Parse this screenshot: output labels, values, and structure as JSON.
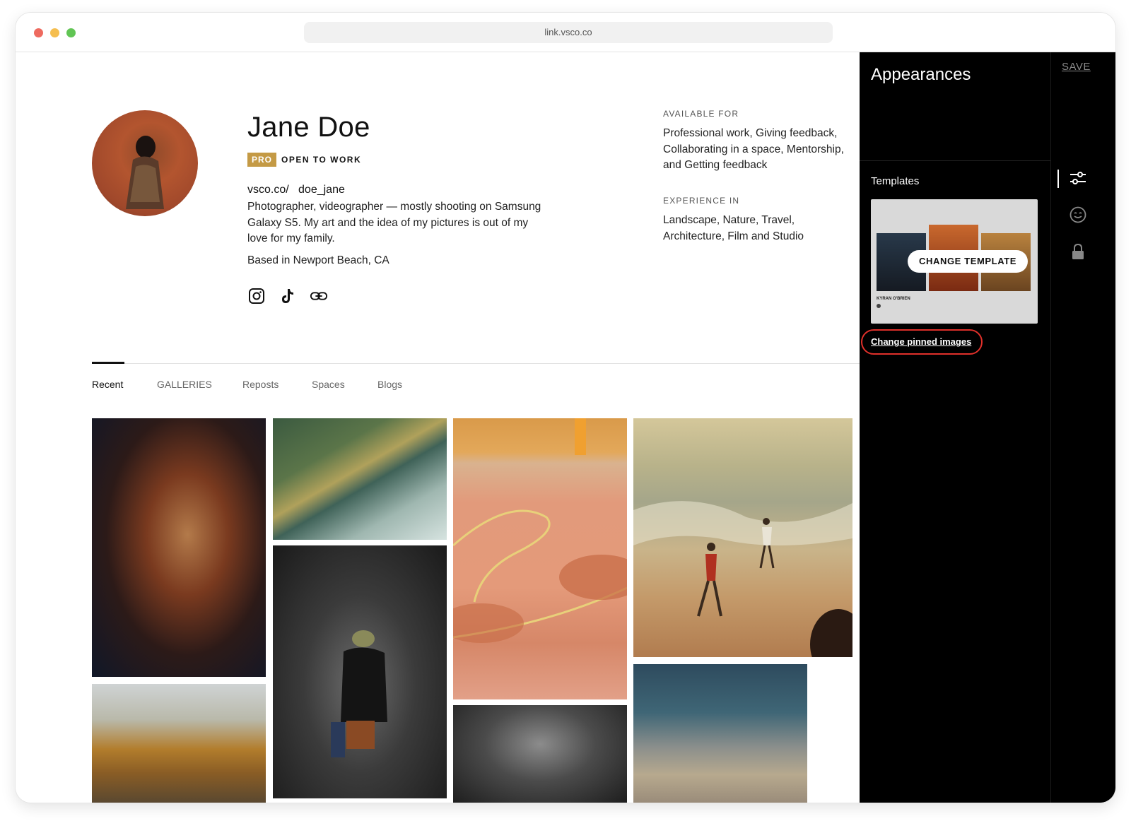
{
  "browser": {
    "url": "link.vsco.co"
  },
  "profile": {
    "name": "Jane Doe",
    "pro_badge": "PRO",
    "status": "OPEN TO WORK",
    "handle": "vsco.co/   doe_jane",
    "bio": "Photographer, videographer — mostly shooting on Samsung Galaxy S5. My art and the idea of my pictures is out of my love for my family.",
    "location": "Based in Newport Beach, CA",
    "socials": [
      "instagram-icon",
      "tiktok-icon",
      "link-icon"
    ]
  },
  "availability": {
    "label": "AVAILABLE FOR",
    "text": "Professional work, Giving feedback, Collaborating in a space, Mentorship, and Getting feedback"
  },
  "experience": {
    "label": "EXPERIENCE IN",
    "text": "Landscape, Nature, Travel, Architecture, Film and Studio"
  },
  "tabs": [
    {
      "label": "Recent",
      "active": true
    },
    {
      "label": "GALLERIES"
    },
    {
      "label": "Reposts"
    },
    {
      "label": "Spaces"
    },
    {
      "label": "Blogs"
    }
  ],
  "panel": {
    "title": "Appearances",
    "save_label": "SAVE",
    "templates_label": "Templates",
    "template_preview_name": "KYRAN O'BRIEN",
    "change_template_label": "CHANGE TEMPLATE",
    "pinned_link_label": "Change pinned images",
    "rail_icons": [
      "sliders-icon",
      "smiley-icon",
      "lock-icon"
    ]
  },
  "colors": {
    "pro_badge": "#c49a45",
    "highlight_ring": "#e0302a",
    "panel_bg": "#000000"
  }
}
